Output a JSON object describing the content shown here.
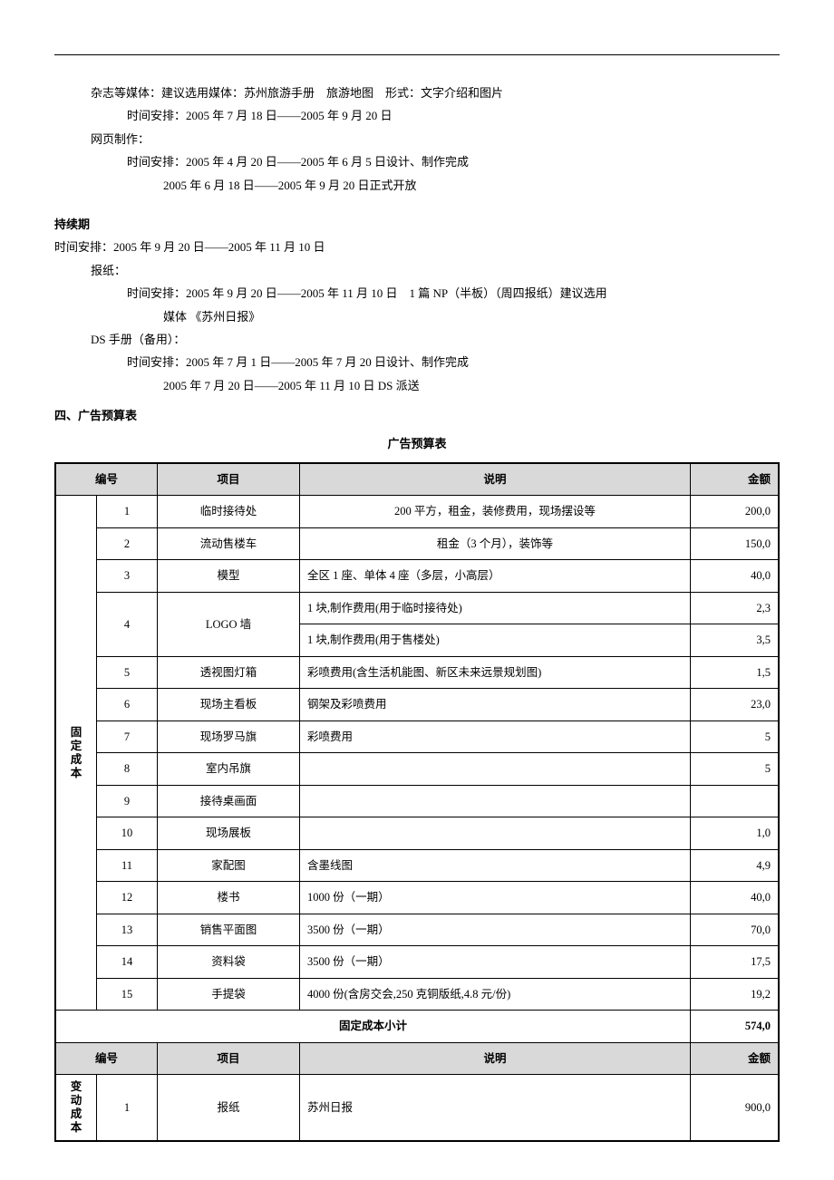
{
  "top": {
    "line1": "杂志等媒体：建议选用媒体：苏州旅游手册　旅游地图　形式：文字介绍和图片",
    "line2": "时间安排：2005 年 7 月 18 日——2005 年 9 月 20 日",
    "line3": "网页制作：",
    "line4": "时间安排：2005 年 4 月 20 日——2005 年 6 月 5 日设计、制作完成",
    "line5": "2005 年 6 月 18 日——2005 年 9 月 20 日正式开放"
  },
  "sustain": {
    "heading": "持续期",
    "time": "时间安排：2005 年 9 月 20 日——2005 年 11 月 10 日",
    "news_label": "报纸：",
    "news_time": "时间安排：2005 年 9 月 20 日——2005 年 11 月 10 日　1 篇 NP（半板）（周四报纸）建议选用",
    "news_time2": "媒体 《苏州日报》",
    "ds_label": "DS 手册（备用）：",
    "ds_time1": "时间安排：2005 年 7 月 1 日——2005 年 7 月 20 日设计、制作完成",
    "ds_time2": "2005 年 7 月 20 日——2005 年 11 月 10 日 DS 派送"
  },
  "section4": "四、广告预算表",
  "table_title": "广告预算表",
  "headers": {
    "id": "编号",
    "item": "项目",
    "desc": "说明",
    "amt": "金额"
  },
  "fixed_label": "固定成本",
  "fixed_rows": [
    {
      "id": "1",
      "item": "临时接待处",
      "desc": "200 平方，租金，装修费用，现场摆设等",
      "amt": "200,0"
    },
    {
      "id": "2",
      "item": "流动售楼车",
      "desc": "租金（3 个月），装饰等",
      "amt": "150,0"
    },
    {
      "id": "3",
      "item": "模型",
      "desc": "全区 1 座、单体 4 座（多层，小高层）",
      "amt": "40,0"
    },
    {
      "id": "4",
      "item": "LOGO 墙",
      "desc": "1 块,制作费用(用于临时接待处)",
      "amt": "2,3",
      "rowspan": 2
    },
    {
      "id": "",
      "item": "",
      "desc": "1 块,制作费用(用于售楼处)",
      "amt": "3,5"
    },
    {
      "id": "5",
      "item": "透视图灯箱",
      "desc": "彩喷费用(含生活机能图、新区未来远景规划图)",
      "amt": "1,5"
    },
    {
      "id": "6",
      "item": "现场主看板",
      "desc": "钢架及彩喷费用",
      "amt": "23,0"
    },
    {
      "id": "7",
      "item": "现场罗马旗",
      "desc": "彩喷费用",
      "amt": "5"
    },
    {
      "id": "8",
      "item": "室内吊旗",
      "desc": "",
      "amt": "5"
    },
    {
      "id": "9",
      "item": "接待桌画面",
      "desc": "",
      "amt": ""
    },
    {
      "id": "10",
      "item": "现场展板",
      "desc": "",
      "amt": "1,0"
    },
    {
      "id": "11",
      "item": "家配图",
      "desc": "含墨线图",
      "amt": "4,9"
    },
    {
      "id": "12",
      "item": "楼书",
      "desc": "1000 份（一期）",
      "amt": "40,0"
    },
    {
      "id": "13",
      "item": "销售平面图",
      "desc": "3500 份（一期）",
      "amt": "70,0"
    },
    {
      "id": "14",
      "item": "资料袋",
      "desc": "3500 份（一期）",
      "amt": "17,5"
    },
    {
      "id": "15",
      "item": "手提袋",
      "desc": "4000 份(含房交会,250 克铜版纸,4.8 元/份)",
      "amt": "19,2"
    }
  ],
  "fixed_subtotal": {
    "label": "固定成本小计",
    "amt": "574,0"
  },
  "var_label": "变动成本",
  "var_rows": [
    {
      "id": "1",
      "item": "报纸",
      "desc": "苏州日报",
      "amt": "900,0"
    }
  ]
}
